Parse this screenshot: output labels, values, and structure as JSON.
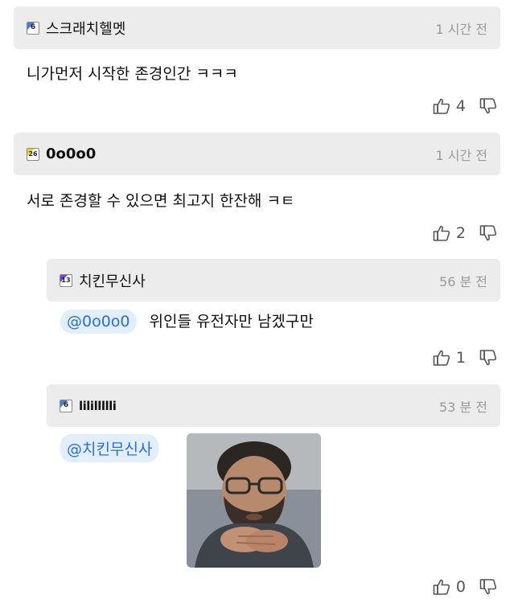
{
  "comments": [
    {
      "level": "6",
      "level_color": "#4a7fd6",
      "username": "스크래치헬멧",
      "time": "1 시간 전",
      "text": "니가먼저 시작한 존경인간 ㅋㅋㅋ",
      "likes": "4"
    },
    {
      "level": "26",
      "level_color": "#f2d21a",
      "username": "0o0o0",
      "time": "1 시간 전",
      "text": "서로 존경할 수 있으면 최고지 한잔해 ㅋㅌ",
      "likes": "2"
    },
    {
      "level": "13",
      "level_color": "#7b3fe0",
      "username": "치킨무신사",
      "time": "56 분 전",
      "mention": "@0o0o0",
      "text": "위인들 유전자만 남겠구만",
      "likes": "1"
    },
    {
      "level": "6",
      "level_color": "#4a7fd6",
      "username": "lilillllli",
      "time": "53 분 전",
      "mention": "@치킨무신사",
      "image": "photo of bearded man with glasses resting chin on clasped hands",
      "likes": "0"
    }
  ],
  "icons": {
    "like": "thumbs-up-icon",
    "dislike": "thumbs-down-icon"
  }
}
